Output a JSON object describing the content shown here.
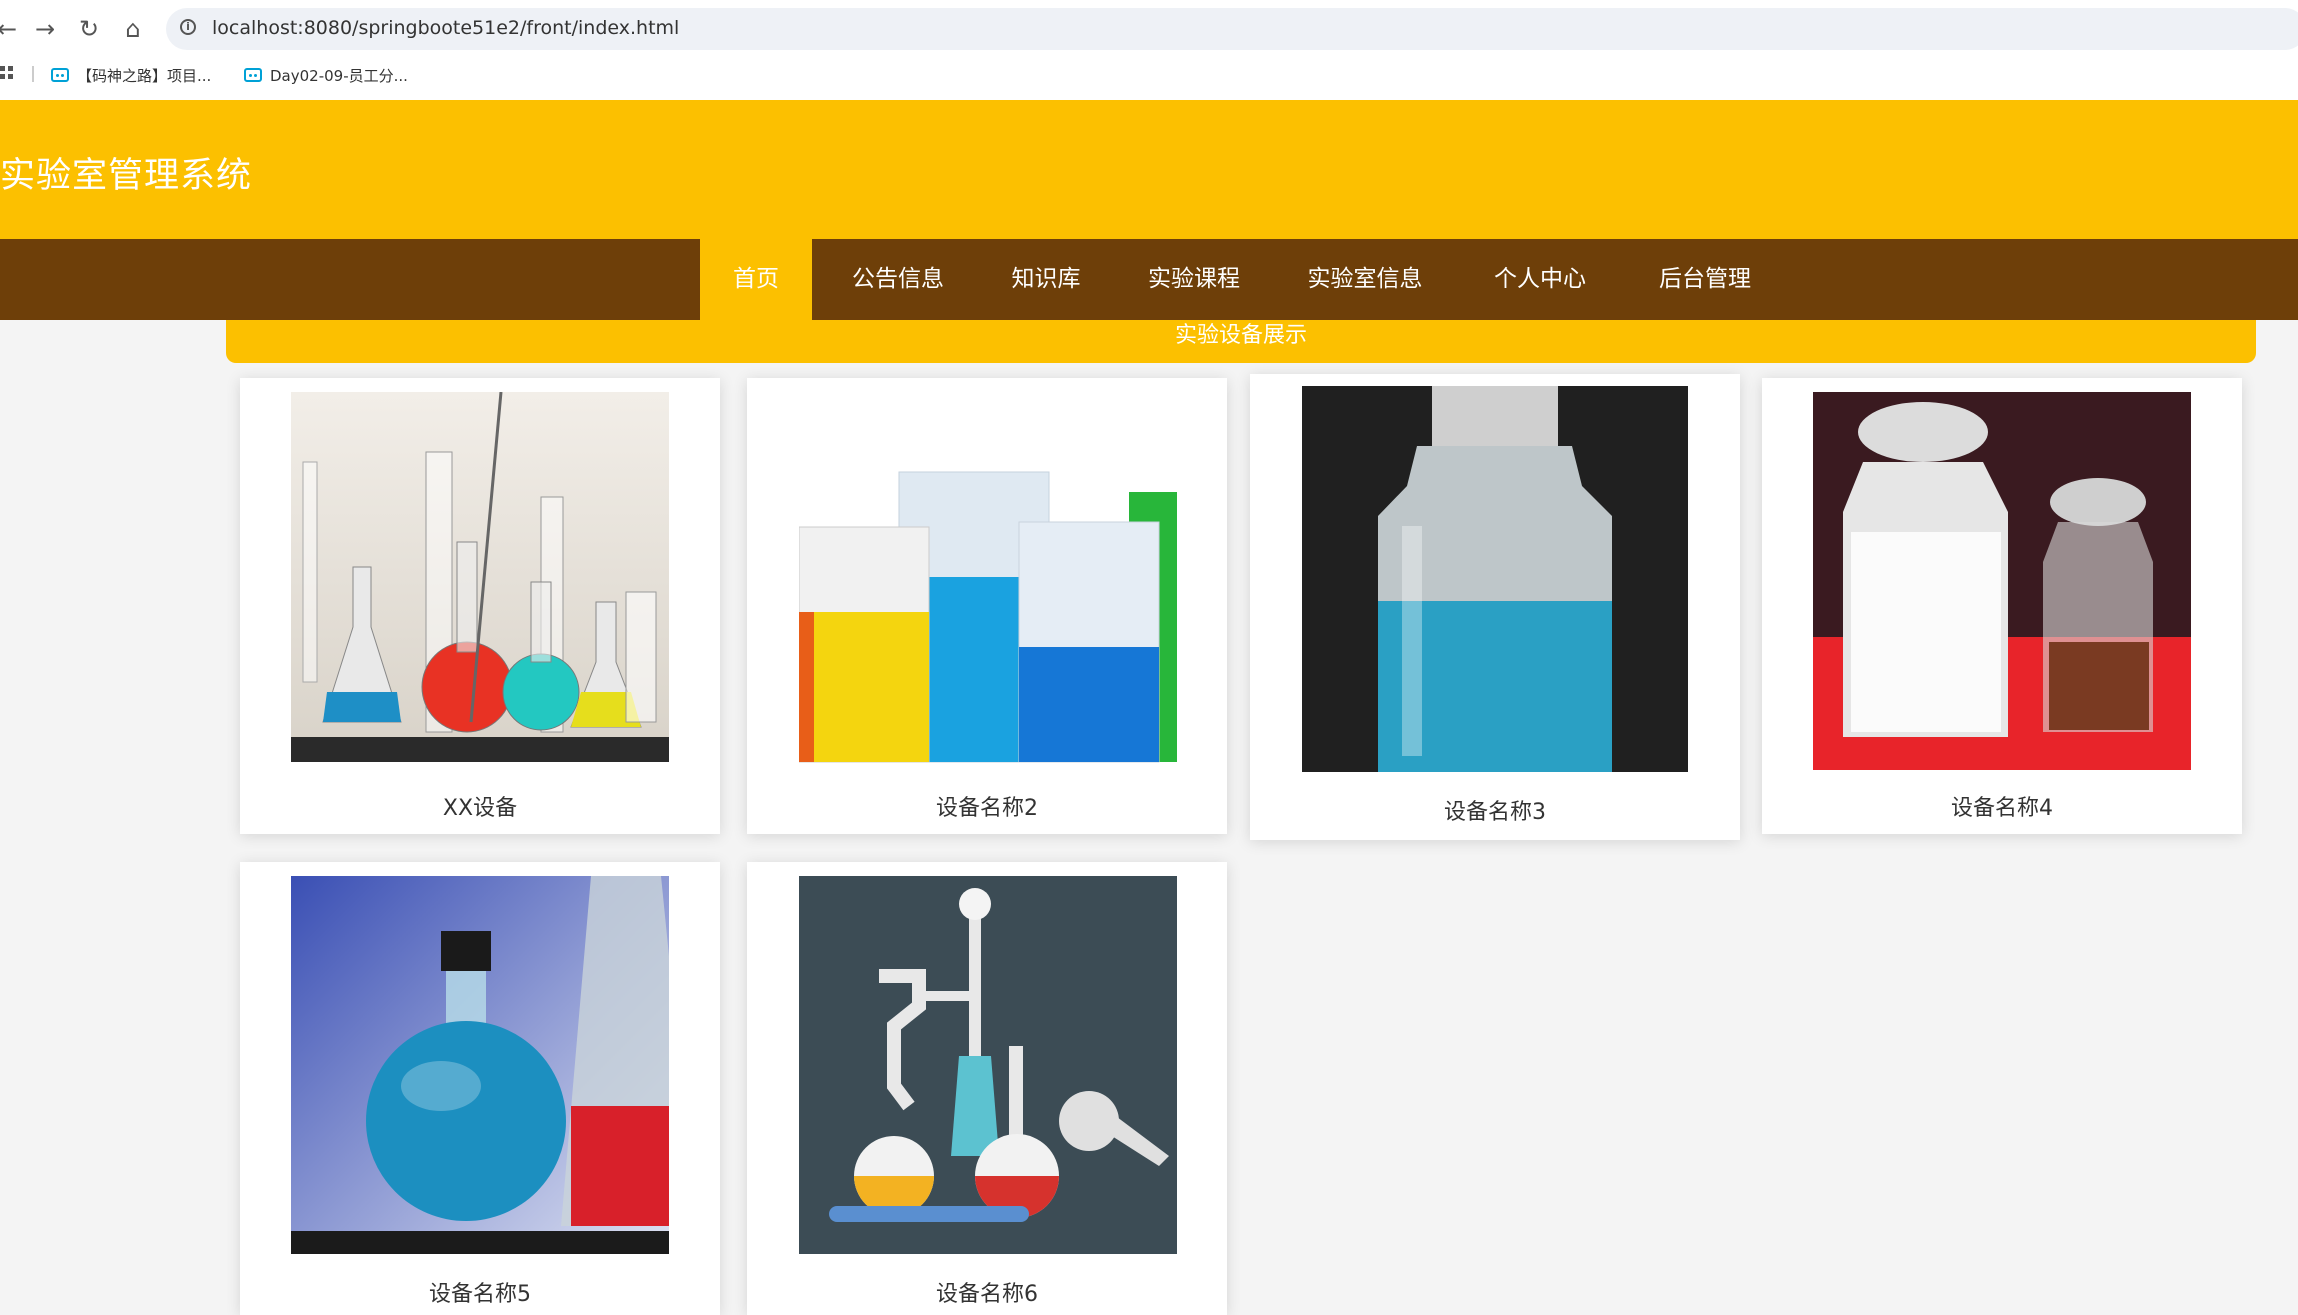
{
  "browser": {
    "back_glyph": "←",
    "forward_glyph": "→",
    "reload_glyph": "↻",
    "home_glyph": "⌂",
    "url": "localhost:8080/springboote51e2/front/index.html",
    "bookmarks": [
      {
        "label": "【码神之路】项目...",
        "icon": "bilibili-tv-icon"
      },
      {
        "label": "Day02-09-员工分...",
        "icon": "bilibili-tv-icon"
      }
    ]
  },
  "site": {
    "title": "实验室管理系统",
    "nav": [
      {
        "label": "首页",
        "active": true
      },
      {
        "label": "公告信息",
        "active": false
      },
      {
        "label": "知识库",
        "active": false
      },
      {
        "label": "实验课程",
        "active": false
      },
      {
        "label": "实验室信息",
        "active": false
      },
      {
        "label": "个人中心",
        "active": false
      },
      {
        "label": "后台管理",
        "active": false
      }
    ],
    "section_title": "实验设备展示",
    "colors": {
      "header": "#fcc000",
      "nav": "#6e3f09",
      "nav_active": "#fcc000"
    }
  },
  "equipment": [
    {
      "name": "XX设备",
      "image": "lab-glassware-photo"
    },
    {
      "name": "设备名称2",
      "image": "colored-beakers-photo"
    },
    {
      "name": "设备名称3",
      "image": "blue-liquid-bottle-photo"
    },
    {
      "name": "设备名称4",
      "image": "reagent-jars-photo"
    },
    {
      "name": "设备名称5",
      "image": "blue-flask-photo"
    },
    {
      "name": "设备名称6",
      "image": "glassware-illustration"
    }
  ]
}
